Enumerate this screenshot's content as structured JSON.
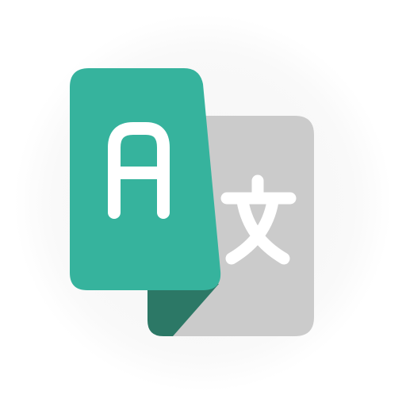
{
  "app_icon": {
    "name": "translate-app-icon",
    "colors": {
      "background": "#ffffff",
      "halo": "#f7f7f7",
      "front_card": "#36b39d",
      "fold_shadow": "#2c7866",
      "back_card": "#cbcbcb",
      "glyph": "#ffffff"
    },
    "front_glyph": "A",
    "back_glyph": "文"
  }
}
